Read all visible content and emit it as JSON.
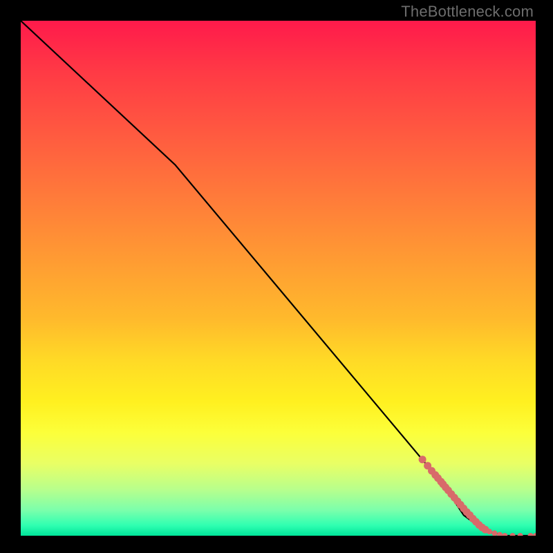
{
  "watermark": "TheBottleneck.com",
  "colors": {
    "frame": "#000000",
    "line": "#000000",
    "dot": "#d86a6a",
    "gradient_stops": [
      "#ff1a4b",
      "#ff3a45",
      "#ff5a40",
      "#ff7a3a",
      "#ff9a33",
      "#ffba2c",
      "#ffda26",
      "#fff020",
      "#fcff3a",
      "#e9ff65",
      "#b8ff8c",
      "#7cffab",
      "#2fffb1",
      "#00e49a"
    ]
  },
  "chart_data": {
    "type": "line",
    "title": "",
    "xlabel": "",
    "ylabel": "",
    "xlim": [
      0,
      100
    ],
    "ylim": [
      0,
      100
    ],
    "grid": false,
    "series": [
      {
        "name": "curve",
        "x": [
          0,
          30,
          82,
          86,
          90,
          94,
          100
        ],
        "y": [
          100,
          72,
          10,
          4,
          1,
          0,
          0
        ]
      }
    ],
    "points": {
      "name": "data-points",
      "comment": "Salmon-colored sample dots lying on/near the curve, clustered bottom-right.",
      "x": [
        78,
        79,
        79.8,
        80.5,
        81,
        81.6,
        82,
        82.5,
        83,
        83.6,
        84.2,
        84.8,
        85.4,
        86,
        86.6,
        87.2,
        87.8,
        88.4,
        89,
        89.6,
        90.2,
        91,
        92,
        93,
        94,
        95.5,
        97,
        99,
        100
      ],
      "y": [
        14.8,
        13.6,
        12.6,
        11.8,
        11.2,
        10.5,
        10,
        9.4,
        8.8,
        8.1,
        7.4,
        6.7,
        6,
        5.3,
        4.6,
        4.0,
        3.3,
        2.7,
        2.1,
        1.6,
        1.2,
        0.8,
        0.5,
        0.2,
        0,
        0,
        0,
        0,
        0
      ]
    }
  }
}
